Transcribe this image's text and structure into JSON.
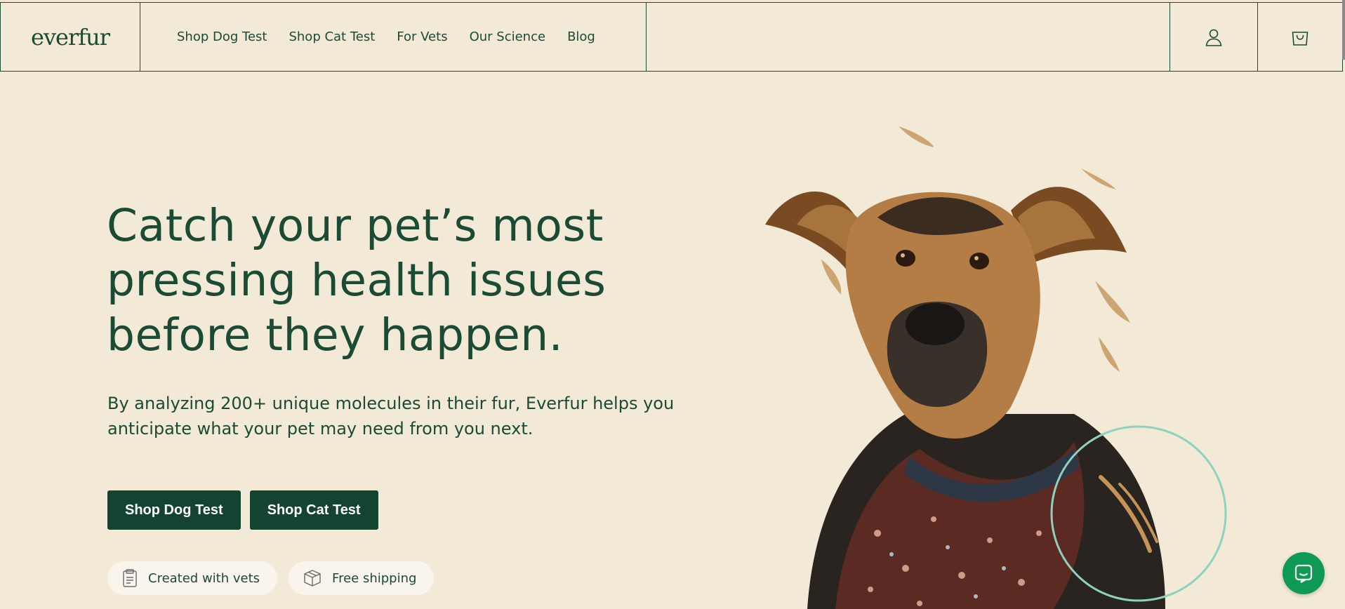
{
  "brand": {
    "logo": "everfur"
  },
  "nav": {
    "links": [
      "Shop Dog Test",
      "Shop Cat Test",
      "For Vets",
      "Our Science",
      "Blog"
    ]
  },
  "header_icons": {
    "account": "account-icon",
    "cart": "cart-icon"
  },
  "hero": {
    "title": "Catch your pet’s most pressing health issues before they happen.",
    "subtitle": "By analyzing 200+ unique molecules in their fur, Everfur helps you anticipate what your pet may need from you next.",
    "buttons": [
      "Shop Dog Test",
      "Shop Cat Test"
    ],
    "badges": [
      {
        "icon": "clipboard-icon",
        "label": "Created with vets"
      },
      {
        "icon": "box-icon",
        "label": "Free shipping"
      }
    ]
  },
  "chat": {
    "icon": "chat-icon"
  },
  "colors": {
    "background": "#f2ead6",
    "primary": "#1b4a35",
    "button": "#144331",
    "chat": "#0e9a52",
    "accent_circle": "#8fd1c0"
  }
}
